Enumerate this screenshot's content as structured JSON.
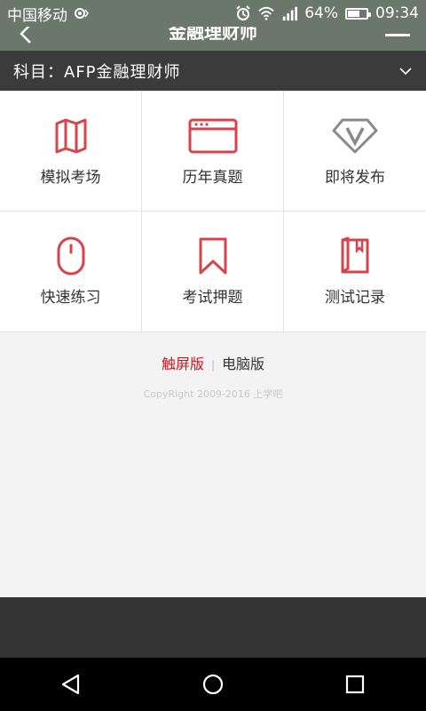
{
  "statusbar": {
    "carrier": "中国移动",
    "battery_percent_label": "64%",
    "battery_level": 0.64,
    "time": "09:34"
  },
  "appbar": {
    "title": "金融理财师"
  },
  "subject": {
    "label": "科目：AFP金融理财师"
  },
  "grid": [
    {
      "label": "模拟考场",
      "icon": "map-icon"
    },
    {
      "label": "历年真题",
      "icon": "browser-window-icon"
    },
    {
      "label": "即将发布",
      "icon": "diamond-v-icon"
    },
    {
      "label": "快速练习",
      "icon": "mouse-icon"
    },
    {
      "label": "考试押题",
      "icon": "bookmark-icon"
    },
    {
      "label": "测试记录",
      "icon": "book-icon"
    }
  ],
  "versions": {
    "touch": "触屏版",
    "separator": "|",
    "pc": "电脑版"
  },
  "copyright": "CopyRight 2009-2016 上学吧",
  "colors": {
    "accent_red": "#c7181e",
    "icon_red": "#d9434a",
    "icon_gray": "#8a8a8a",
    "header": "#6c776b",
    "subject_bar": "#3b3b3b"
  }
}
